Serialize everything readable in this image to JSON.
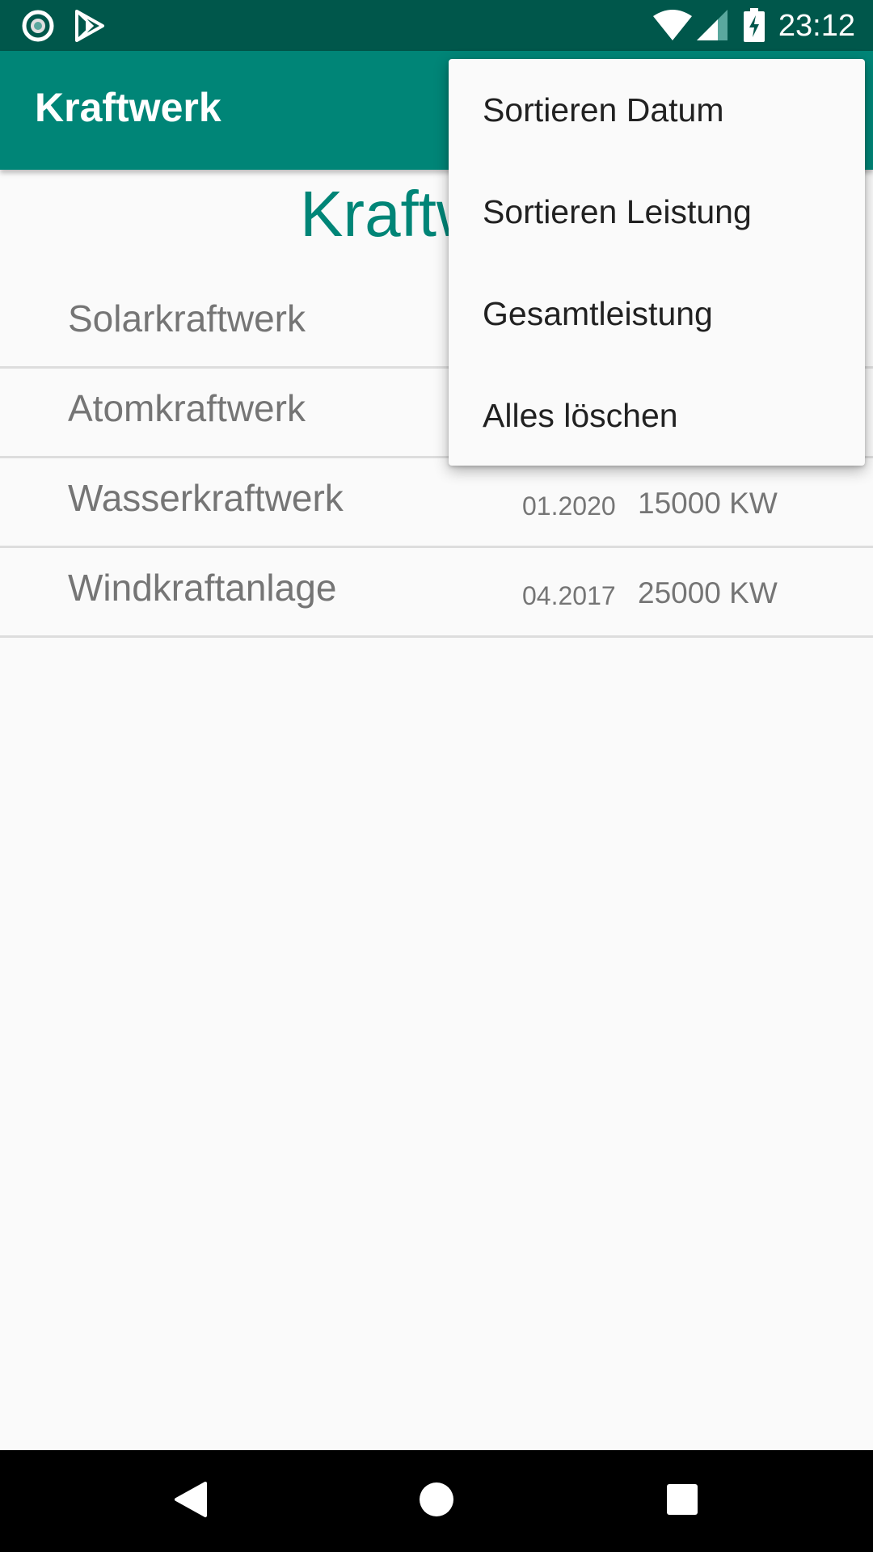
{
  "status_bar": {
    "time": "23:12",
    "icons": [
      "circle-notification-icon",
      "play-store-icon",
      "wifi-icon",
      "cell-signal-icon",
      "battery-charging-icon"
    ]
  },
  "app_bar": {
    "title": "Kraftwerk"
  },
  "content": {
    "heading": "Kraftwerk",
    "items": [
      {
        "name": "Solarkraftwerk",
        "date": "",
        "power": ""
      },
      {
        "name": "Atomkraftwerk",
        "date": "",
        "power": ""
      },
      {
        "name": "Wasserkraftwerk",
        "date": "01.2020",
        "power": "15000 KW"
      },
      {
        "name": "Windkraftanlage",
        "date": "04.2017",
        "power": "25000 KW"
      }
    ]
  },
  "menu": {
    "items": [
      {
        "label": "Sortieren Datum"
      },
      {
        "label": "Sortieren Leistung"
      },
      {
        "label": "Gesamtleistung"
      },
      {
        "label": "Alles löschen"
      }
    ]
  },
  "nav_bar": {
    "buttons": [
      "back-icon",
      "home-icon",
      "recents-icon"
    ]
  },
  "colors": {
    "status_bar": "#00574b",
    "primary": "#008577",
    "background": "#fafafa",
    "secondary_text": "#757575",
    "menu_text": "#212121"
  }
}
